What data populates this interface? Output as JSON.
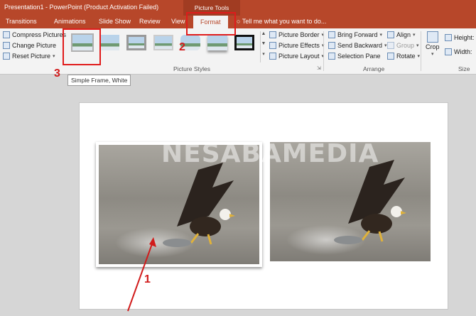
{
  "window": {
    "title": "Presentation1 - PowerPoint (Product Activation Failed)",
    "context_title": "Picture Tools"
  },
  "tabs": [
    "Transitions",
    "Animations",
    "Slide Show",
    "Review",
    "View",
    "Format"
  ],
  "tell_me": "Tell me what you want to do...",
  "ribbon": {
    "adjust": [
      "Compress Pictures",
      "Change Picture",
      "Reset Picture"
    ],
    "styles_group_label": "Picture Styles",
    "picture_style_options": [
      "Picture Border",
      "Picture Effects",
      "Picture Layout"
    ],
    "arrange_left": [
      "Bring Forward",
      "Send Backward",
      "Selection Pane"
    ],
    "arrange_right": [
      "Align",
      "Group",
      "Rotate"
    ],
    "arrange_group_label": "Arrange",
    "crop_label": "Crop",
    "size_labels": [
      "Height:",
      "Width:"
    ],
    "size_group_label": "Size"
  },
  "tooltip": "Simple Frame, White",
  "slide": {
    "watermark": "NESABAMEDIA"
  },
  "annotations": [
    "1",
    "2",
    "3"
  ]
}
